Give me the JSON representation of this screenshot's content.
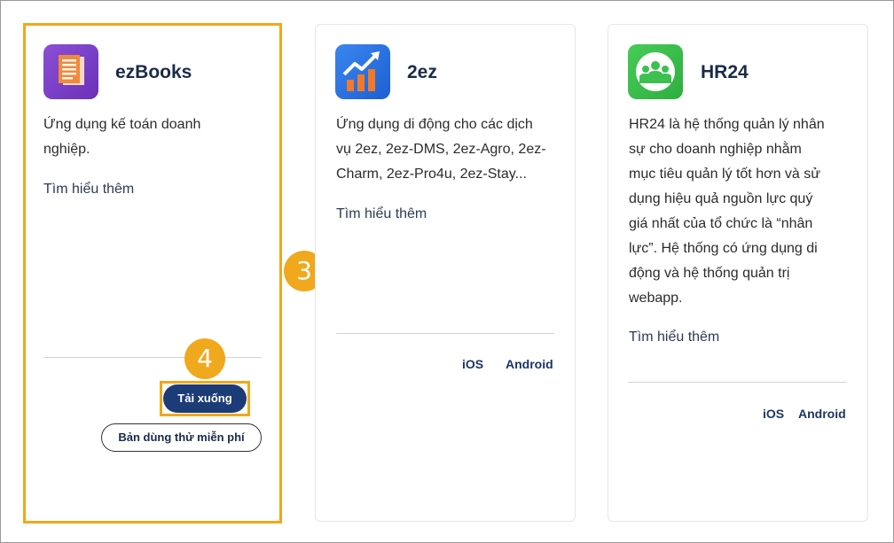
{
  "colors": {
    "highlight": "#f0a81c",
    "primary_button": "#1c3c78",
    "ezbooks_icon_bg": "#7a3fc4",
    "twoez_icon_bg": "#2f74e6",
    "hr24_icon_bg": "#3cc04e"
  },
  "annotations": {
    "badge_3": "3",
    "badge_4": "4"
  },
  "cards": [
    {
      "name": "ezBooks",
      "icon": "document-stack-icon",
      "description_lines": [
        "Ứng dụng kế toán doanh",
        "nghiệp."
      ],
      "learn_more": "Tìm hiểu thêm",
      "download_button": "Tải xuống",
      "trial_button": "Bản dùng thử miễn phí"
    },
    {
      "name": "2ez",
      "icon": "growth-chart-icon",
      "description_lines": [
        "Ứng dụng di động cho các dịch",
        "vụ 2ez, 2ez-DMS, 2ez-Agro, 2ez-",
        "Charm, 2ez-Pro4u, 2ez-Stay..."
      ],
      "learn_more": "Tìm hiểu thêm",
      "links": [
        "iOS",
        "Android"
      ]
    },
    {
      "name": "HR24",
      "icon": "people-group-icon",
      "description_lines": [
        "HR24 là hệ thống quản lý nhân",
        "sự cho doanh nghiệp nhằm",
        "mục tiêu quản lý tốt hơn và sử",
        "dụng hiệu quả nguồn lực quý",
        "giá nhất của tổ chức là “nhân",
        "lực”. Hệ thống có ứng dụng di",
        "động và hệ thống quản trị",
        "webapp."
      ],
      "learn_more": "Tìm hiểu thêm",
      "links": [
        "iOS",
        "Android"
      ]
    }
  ]
}
